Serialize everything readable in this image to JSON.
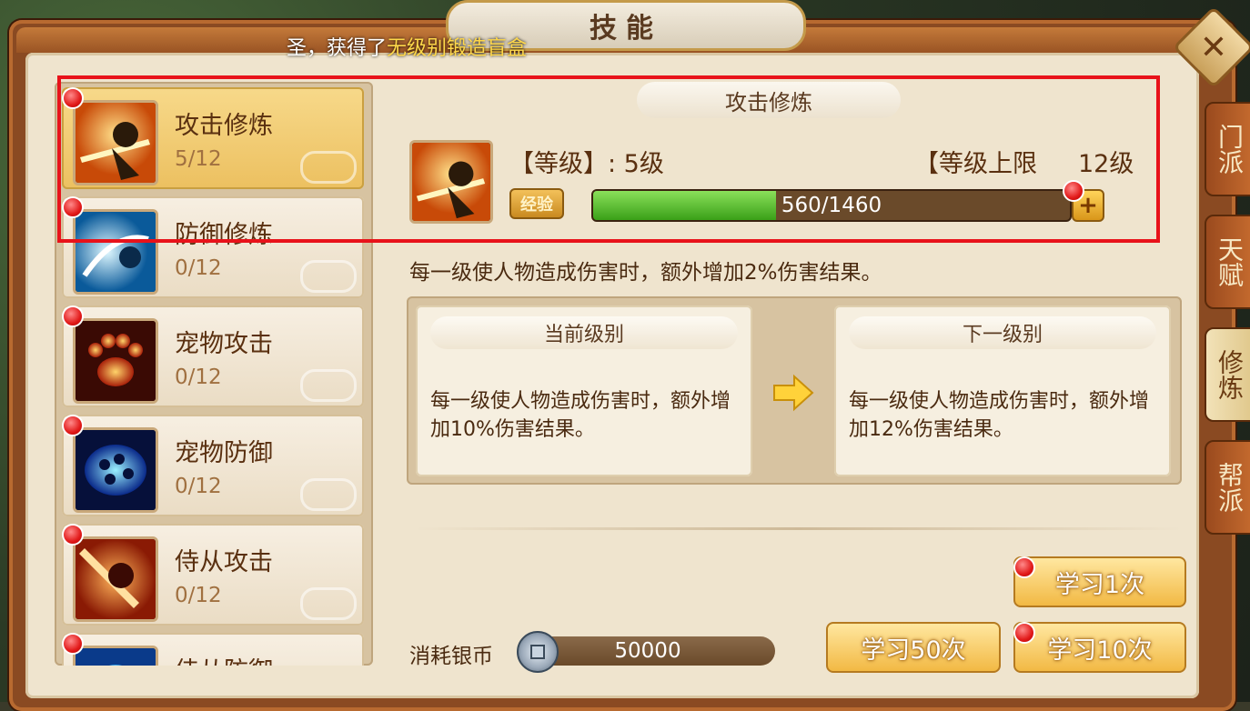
{
  "window": {
    "title": "技能",
    "close_icon": "close-icon"
  },
  "announcement": {
    "prefix": "圣，获得了",
    "highlight": "无级别锻造盲盒"
  },
  "side_tabs": [
    {
      "label": "门派"
    },
    {
      "label": "天赋"
    },
    {
      "label": "修炼",
      "active": true
    },
    {
      "label": "帮派"
    }
  ],
  "skills": [
    {
      "name": "攻击修炼",
      "level": "5/12",
      "selected": true,
      "icon": "sword-strike-icon",
      "color": "#f08a1a"
    },
    {
      "name": "防御修炼",
      "level": "0/12",
      "icon": "shield-swirl-icon",
      "color": "#3ab6ea"
    },
    {
      "name": "宠物攻击",
      "level": "0/12",
      "icon": "paw-icon",
      "color": "#e8461a"
    },
    {
      "name": "宠物防御",
      "level": "0/12",
      "icon": "blue-shell-icon",
      "color": "#1a6ae8"
    },
    {
      "name": "侍从攻击",
      "level": "0/12",
      "icon": "warrior-strike-icon",
      "color": "#e86a1a"
    },
    {
      "name": "侍从防御",
      "level": "",
      "icon": "blue-orb-icon",
      "color": "#1a8ae8"
    }
  ],
  "detail": {
    "title": "攻击修炼",
    "level_label": "【等级】: 5级",
    "max_label": "【等级上限",
    "max_value": "12级",
    "exp_badge": "经验",
    "exp_text": "560/1460",
    "exp_fraction": 0.3836,
    "description": "每一级使人物造成伤害时，额外增加2%伤害结果。"
  },
  "compare": {
    "current": {
      "header": "当前级别",
      "text": "每一级使人物造成伤害时，额外增加10%伤害结果。"
    },
    "next": {
      "header": "下一级别",
      "text": "每一级使人物造成伤害时，额外增加12%伤害结果。"
    }
  },
  "cost": {
    "label": "消耗银币",
    "value": "50000"
  },
  "buttons": {
    "learn1": "学习1次",
    "learn10": "学习10次",
    "learn50": "学习50次"
  }
}
